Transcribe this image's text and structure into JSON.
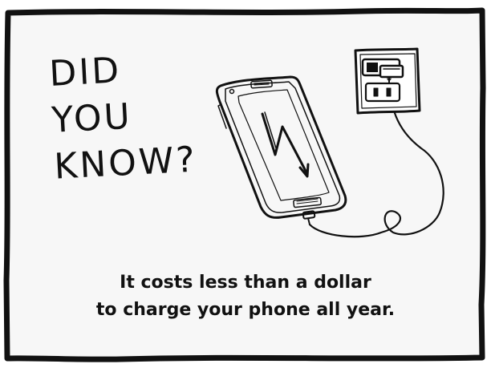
{
  "headline": {
    "line1": "DID",
    "line2": "YOU",
    "line3": "KNOW?"
  },
  "caption": {
    "line1": "It costs less than a dollar",
    "line2": "to charge your phone all year."
  },
  "colors": {
    "ink": "#111111",
    "panel": "#f7f7f7",
    "background": "#ffffff"
  },
  "illustration": {
    "phone_icon": "smartphone-icon",
    "bolt_icon": "lightning-bolt-icon",
    "outlet_icon": "wall-outlet-icon",
    "charger_icon": "charger-plug-icon",
    "cable_icon": "charging-cable-icon"
  }
}
